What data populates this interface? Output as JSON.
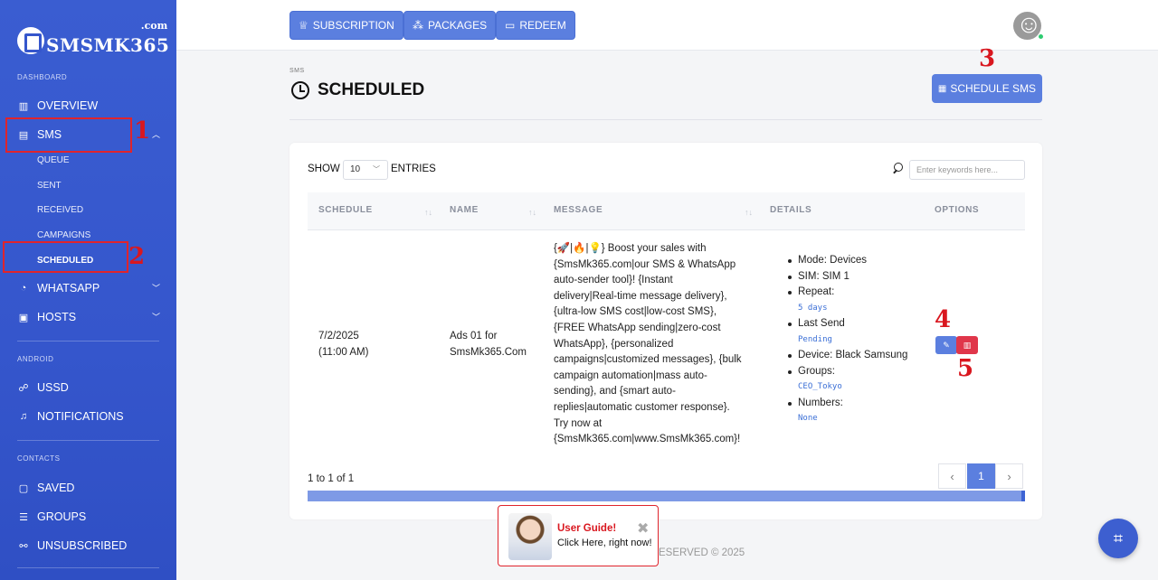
{
  "brand": {
    "name": "SMSMK365",
    "suffix": ".com"
  },
  "sidebar": {
    "sections": {
      "dashboard": "DASHBOARD",
      "android": "ANDROID",
      "contacts": "CONTACTS"
    },
    "items": {
      "overview": "OVERVIEW",
      "sms": "SMS",
      "queue": "QUEUE",
      "sent": "SENT",
      "received": "RECEIVED",
      "campaigns": "CAMPAIGNS",
      "scheduled": "SCHEDULED",
      "whatsapp": "WHATSAPP",
      "hosts": "HOSTS",
      "ussd": "USSD",
      "notifications": "NOTIFICATIONS",
      "saved": "SAVED",
      "groups": "GROUPS",
      "unsubscribed": "UNSUBSCRIBED"
    }
  },
  "callouts": {
    "one": "1",
    "two": "2",
    "three": "3",
    "four": "4",
    "five": "5"
  },
  "topbar": {
    "subscription": "SUBSCRIPTION",
    "packages": "PACKAGES",
    "redeem": "REDEEM"
  },
  "page": {
    "breadcrumb": "SMS",
    "title": "SCHEDULED",
    "schedule_button": "SCHEDULE SMS"
  },
  "table_controls": {
    "show_label": "SHOW",
    "page_size": "10",
    "entries_label": "ENTRIES",
    "search_placeholder": "Enter keywords here..."
  },
  "table": {
    "columns": [
      "SCHEDULE",
      "NAME",
      "MESSAGE",
      "DETAILS",
      "OPTIONS"
    ],
    "rows": [
      {
        "schedule_date": "7/2/2025",
        "schedule_time": "(11:00 AM)",
        "name_line1": "Ads 01 for",
        "name_line2": "SmsMk365.Com",
        "message_lines": [
          "{🚀|🔥|💡} Boost your sales with",
          "{SmsMk365.com|our SMS & WhatsApp",
          "auto-sender tool}! {Instant",
          "delivery|Real-time message delivery},",
          "{ultra-low SMS cost|low-cost SMS},",
          "{FREE WhatsApp sending|zero-cost",
          "WhatsApp}, {personalized",
          "campaigns|customized messages}, {bulk",
          "campaign automation|mass auto-",
          "sending}, and {smart auto-",
          "replies|automatic customer response}.",
          "Try now at",
          "{SmsMk365.com|www.SmsMk365.com}!"
        ],
        "details": {
          "mode": "Mode: Devices",
          "sim": "SIM: SIM 1",
          "repeat_label": "Repeat:",
          "repeat_value": "5 days",
          "last_send_label": "Last Send",
          "last_send_value": "Pending",
          "device": "Device: Black Samsung",
          "groups_label": "Groups:",
          "groups_value": "CEO_Tokyo",
          "numbers_label": "Numbers:",
          "numbers_value": "None"
        }
      }
    ]
  },
  "pagination": {
    "info": "1 to 1 of 1",
    "prev": "‹",
    "current": "1",
    "next": "›"
  },
  "footer": {
    "text": "ESERVED © 2025"
  },
  "user_guide": {
    "title": "User Guide!",
    "subtitle": "Click Here, right now!",
    "close": "✖"
  },
  "colors": {
    "sidebar": "#3556cc",
    "accent": "#5b7fdf",
    "danger": "#e0364a",
    "callout": "#d9171f"
  },
  "icons": {
    "overview": "bar-chart-icon",
    "sms": "message-icon",
    "whatsapp": "whatsapp-icon",
    "hosts": "server-icon",
    "ussd": "signal-icon",
    "notifications": "bell-icon",
    "saved": "contact-card-icon",
    "groups": "list-icon",
    "unsubscribed": "unlink-icon"
  }
}
